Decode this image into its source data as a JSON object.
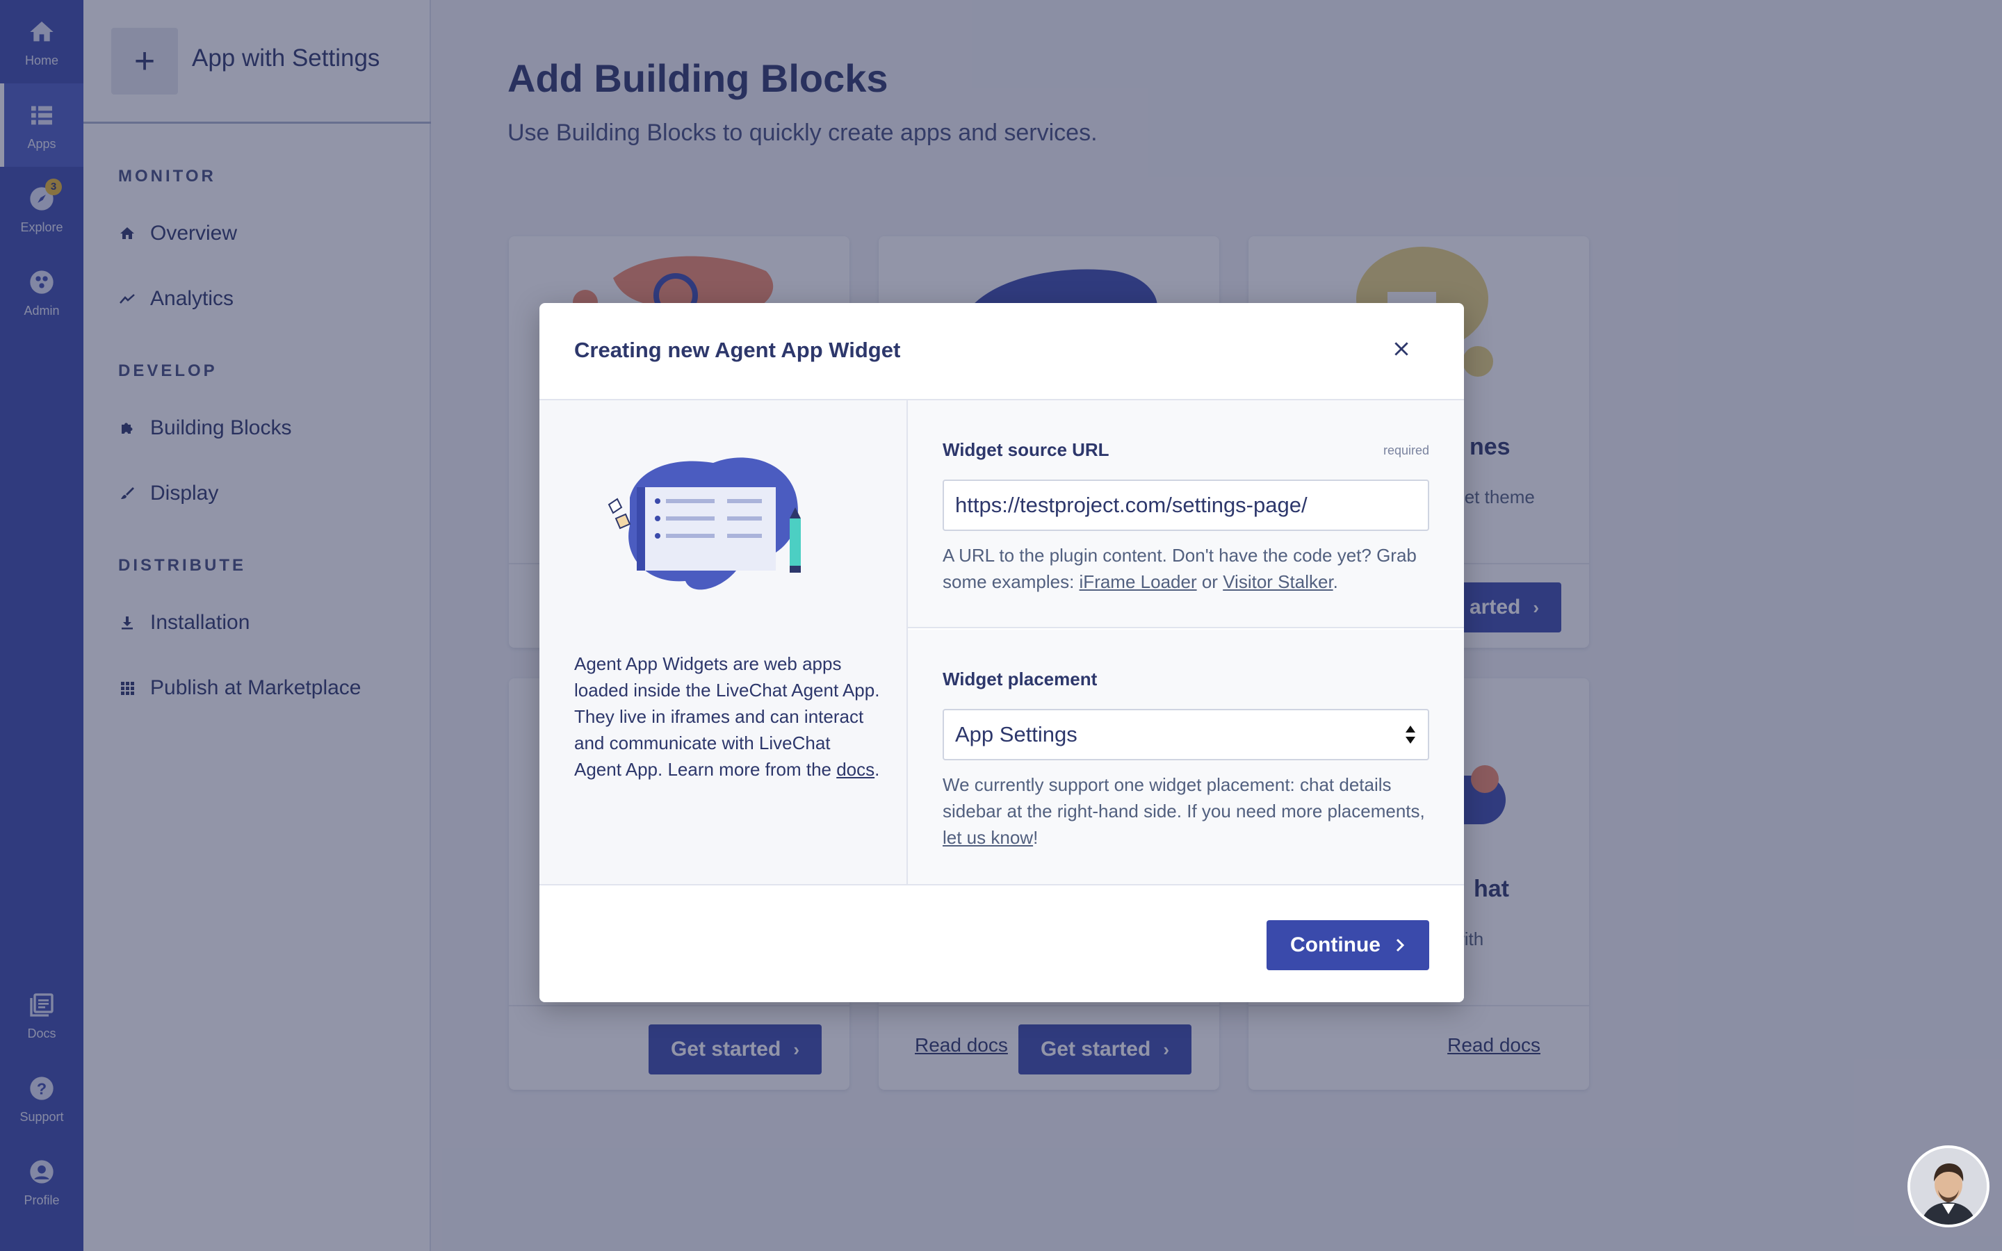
{
  "rail": {
    "items": [
      {
        "label": "Home",
        "icon": "home-icon"
      },
      {
        "label": "Apps",
        "icon": "apps-icon",
        "active": true
      },
      {
        "label": "Explore",
        "icon": "explore-icon",
        "badge": "3"
      },
      {
        "label": "Admin",
        "icon": "admin-icon"
      },
      {
        "label": "Docs",
        "icon": "docs-icon"
      },
      {
        "label": "Support",
        "icon": "support-icon"
      },
      {
        "label": "Profile",
        "icon": "profile-icon"
      }
    ]
  },
  "sidebar": {
    "app_name": "App with Settings",
    "sections": [
      {
        "title": "MONITOR",
        "items": [
          "Overview",
          "Analytics"
        ]
      },
      {
        "title": "DEVELOP",
        "items": [
          "Building Blocks",
          "Display"
        ]
      },
      {
        "title": "DISTRIBUTE",
        "items": [
          "Installation",
          "Publish at Marketplace"
        ]
      }
    ]
  },
  "main": {
    "title": "Add Building Blocks",
    "subtitle": "Use Building Blocks to quickly create apps and services.",
    "cards": [
      {
        "title_fragment": "nes",
        "desc_fragment": "idget theme",
        "button": "arted"
      },
      {
        "title_fragment": "hat",
        "desc_fragment": "with",
        "read_docs": "Read docs"
      },
      {
        "get_started": "Get started"
      },
      {
        "read_docs": "Read docs",
        "get_started": "Get started"
      }
    ]
  },
  "modal": {
    "title": "Creating new Agent App Widget",
    "intro_text": "Agent App Widgets are web apps loaded inside the LiveChat Agent App. They live in iframes and can interact and communicate with LiveChat Agent App. Learn more from the ",
    "intro_link": "docs",
    "intro_end": ".",
    "url_field": {
      "label": "Widget source URL",
      "required": "required",
      "value": "https://testproject.com/settings-page/",
      "help_prefix": "A URL to the plugin content. Don't have the code yet? Grab some examples: ",
      "link1": "iFrame Loader",
      "or": " or ",
      "link2": "Visitor Stalker",
      "end": "."
    },
    "placement_field": {
      "label": "Widget placement",
      "selected": "App Settings",
      "help_prefix": "We currently support one widget placement: chat details sidebar at the right-hand side. If you need more placements, ",
      "link": "let us know",
      "end": "!"
    },
    "continue_label": "Continue"
  },
  "colors": {
    "brand": "#3a4aab",
    "text_dark": "#2d376b",
    "overlay": "rgba(37,44,82,0.5)"
  }
}
